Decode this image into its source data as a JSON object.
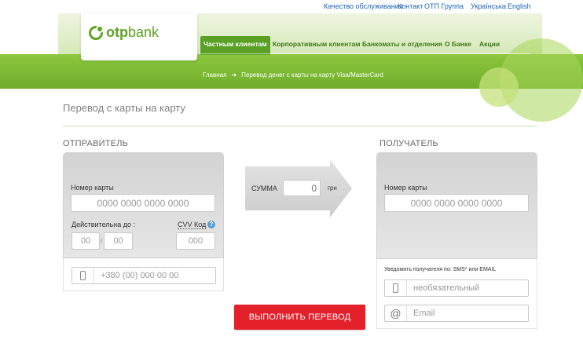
{
  "top_links": {
    "quality": "Качество обслуживания",
    "contact": "Контакт",
    "group": "ОТП Группа",
    "ukrainian": "Українська",
    "english": "English"
  },
  "logo": {
    "part1": "otp",
    "part2": "bank"
  },
  "nav": {
    "private": "Частным клиентам",
    "corporate": "Корпоративным клиентам",
    "atms": "Банкоматы и отделения",
    "about": "О Банке",
    "promo": "Акции"
  },
  "breadcrumb": {
    "home": "Главная",
    "arrow": "➔",
    "current": "Перевод денег с карты на карту Visa/MasterCard"
  },
  "page_title": "Перевод с карты на карту",
  "sender": {
    "title": "ОТПРАВИТЕЛЬ",
    "card_number_label": "Номер карты",
    "card_number_placeholder": "0000 0000 0000 0000",
    "valid_label": "Действительна до :",
    "month_placeholder": "00",
    "slash": "/",
    "year_placeholder": "00",
    "cvv_label": "CVV Код",
    "cvv_help": "?",
    "cvv_placeholder": "000",
    "phone_placeholder": "+380 (00) 000 00 00"
  },
  "amount": {
    "label": "СУММА",
    "value": "0",
    "currency": "грн"
  },
  "recipient": {
    "title": "ПОЛУЧАТЕЛЬ",
    "card_number_label": "Номер карты",
    "card_number_placeholder": "0000 0000 0000 0000",
    "notify_label": "Уведомить получателя по: SMS* или EMAIL",
    "phone_placeholder": "необязательный",
    "email_placeholder": "Email"
  },
  "submit_label": "ВЫПОЛНИТЬ ПЕРЕВОД",
  "colors": {
    "brand_green": "#5ea323",
    "band_green": "#7bbb32",
    "submit_red": "#e4202b",
    "link_blue": "#1c63b8"
  }
}
